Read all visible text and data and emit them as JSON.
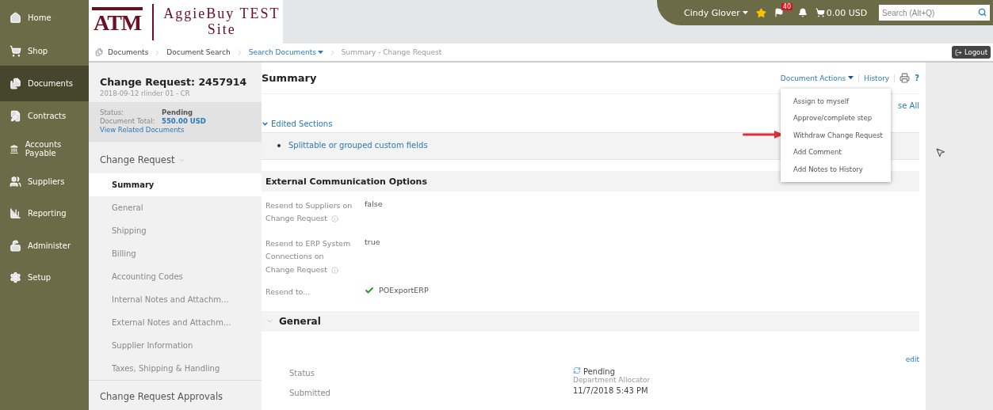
{
  "nav": [
    {
      "label": "Home",
      "selected": false
    },
    {
      "label": "Shop",
      "selected": false
    },
    {
      "label": "Documents",
      "selected": true
    },
    {
      "label": "Contracts",
      "selected": false
    },
    {
      "label": "Accounts Payable",
      "selected": false
    },
    {
      "label": "Suppliers",
      "selected": false
    },
    {
      "label": "Reporting",
      "selected": false
    },
    {
      "label": "Administer",
      "selected": false
    },
    {
      "label": "Setup",
      "selected": false
    }
  ],
  "header": {
    "logo_text": "ATM",
    "site_title": [
      "AggieBuy TEST",
      "Site"
    ]
  },
  "user_bar": {
    "user": "Cindy Glover",
    "flag_count": "40",
    "cart": "0.00 USD",
    "search_placeholder": "Search (Alt+Q)"
  },
  "breadcrumb": [
    {
      "label": "Documents",
      "kind": "plain",
      "dropdown": false
    },
    {
      "label": "Document Search",
      "kind": "plain",
      "dropdown": false
    },
    {
      "label": "Search Documents",
      "kind": "link",
      "dropdown": true
    },
    {
      "label": "Summary - Change Request",
      "kind": "current",
      "dropdown": false
    }
  ],
  "logout": "Logout",
  "document": {
    "title": "Change Request: 2457914",
    "subtitle": "2018-09-12 rlinder 01 - CR",
    "status_label": "Status:",
    "status": "Pending",
    "total_label": "Document Total:",
    "total": "550.00 USD",
    "related": "View Related Documents"
  },
  "section_nav": {
    "heading": "Change Request",
    "items": [
      {
        "label": "Summary",
        "selected": true
      },
      {
        "label": "General",
        "selected": false
      },
      {
        "label": "Shipping",
        "selected": false
      },
      {
        "label": "Billing",
        "selected": false
      },
      {
        "label": "Accounting Codes",
        "selected": false
      },
      {
        "label": "Internal Notes and Attachm...",
        "selected": false
      },
      {
        "label": "External Notes and Attachm...",
        "selected": false
      },
      {
        "label": "Supplier Information",
        "selected": false
      },
      {
        "label": "Taxes, Shipping & Handling",
        "selected": false
      }
    ],
    "next_heading": "Change Request Approvals"
  },
  "main": {
    "title": "Summary",
    "actions": [
      "Document Actions",
      "History"
    ],
    "help": "?",
    "close_all": "se All",
    "edited_sections": {
      "label": "Edited Sections",
      "expanded": true,
      "items": [
        "Splittable or grouped custom fields"
      ]
    },
    "external": {
      "heading": "External Communication Options",
      "rows": [
        {
          "label": "Resend to Suppliers on Change Request",
          "value": "false",
          "kind": "info"
        },
        {
          "label": "Resend to ERP System Connections on Change Request",
          "value": "true",
          "kind": "info"
        },
        {
          "label": "Resend to...",
          "value": "POExportERP",
          "kind": "check"
        }
      ]
    },
    "general": {
      "heading": "General",
      "edit": "edit",
      "rows": [
        {
          "label": "Status",
          "value": "Pending",
          "sub": "Department Allocator",
          "kind": "status"
        },
        {
          "label": "Submitted",
          "value": "11/7/2018 5:43 PM",
          "kind": "plain"
        }
      ]
    }
  },
  "menu": {
    "items": [
      "Assign to myself",
      "Approve/complete step",
      "Withdraw Change Request",
      "Add Comment",
      "Add Notes to History"
    ]
  }
}
